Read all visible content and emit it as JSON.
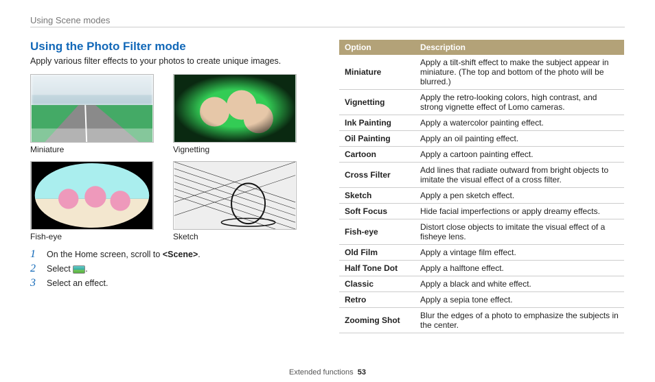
{
  "header": {
    "section": "Using Scene modes"
  },
  "left": {
    "title": "Using the Photo Filter mode",
    "intro": "Apply various filter effects to your photos to create unique images.",
    "thumbs": [
      "Miniature",
      "Vignetting",
      "Fish-eye",
      "Sketch"
    ],
    "steps": {
      "s1a": "On the Home screen, scroll to ",
      "s1b": "<Scene>",
      "s1c": ".",
      "s2a": "Select ",
      "s2b": ".",
      "s3": "Select an effect."
    }
  },
  "table": {
    "head": {
      "c1": "Option",
      "c2": "Description"
    },
    "rows": [
      {
        "option": "Miniature",
        "desc": "Apply a tilt-shift effect to make the subject appear in miniature. (The top and bottom of the photo will be blurred.)"
      },
      {
        "option": "Vignetting",
        "desc": "Apply the retro-looking colors, high contrast, and strong vignette effect of Lomo cameras."
      },
      {
        "option": "Ink Painting",
        "desc": "Apply a watercolor painting effect."
      },
      {
        "option": "Oil Painting",
        "desc": "Apply an oil painting effect."
      },
      {
        "option": "Cartoon",
        "desc": "Apply a cartoon painting effect."
      },
      {
        "option": "Cross Filter",
        "desc": "Add lines that radiate outward from bright objects to imitate the visual effect of a cross filter."
      },
      {
        "option": "Sketch",
        "desc": "Apply a pen sketch effect."
      },
      {
        "option": "Soft Focus",
        "desc": "Hide facial imperfections or apply dreamy effects."
      },
      {
        "option": "Fish-eye",
        "desc": "Distort close objects to imitate the visual effect of a fisheye lens."
      },
      {
        "option": "Old Film",
        "desc": "Apply a vintage film effect."
      },
      {
        "option": "Half Tone Dot",
        "desc": "Apply a halftone effect."
      },
      {
        "option": "Classic",
        "desc": "Apply a black and white effect."
      },
      {
        "option": "Retro",
        "desc": "Apply a sepia tone effect."
      },
      {
        "option": "Zooming Shot",
        "desc": "Blur the edges of a photo to emphasize the subjects in the center."
      }
    ]
  },
  "footer": {
    "label": "Extended functions",
    "page": "53"
  }
}
